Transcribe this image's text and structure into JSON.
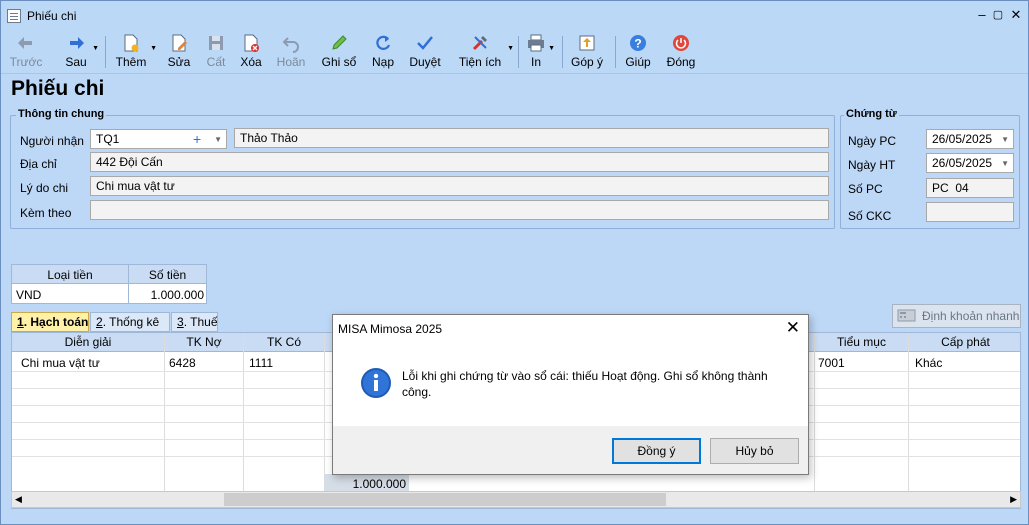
{
  "window": {
    "title": "Phiếu chi"
  },
  "toolbar": {
    "prev": "Trước",
    "next": "Sau",
    "add": "Thêm",
    "edit": "Sửa",
    "save": "Cất",
    "delete": "Xóa",
    "undo": "Hoãn",
    "post": "Ghi sổ",
    "reload": "Nạp",
    "approve": "Duyệt",
    "utilities": "Tiện ích",
    "print": "In",
    "feedback": "Góp ý",
    "help": "Giúp",
    "close": "Đóng"
  },
  "page": {
    "title": "Phiếu chi"
  },
  "general": {
    "group_label": "Thông tin chung",
    "recipient_label": "Người nhận",
    "recipient_code": "TQ1",
    "recipient_name": "Thảo Thảo",
    "address_label": "Địa chỉ",
    "address": "442 Đội Cấn",
    "reason_label": "Lý do chi",
    "reason": "Chi mua vật tư",
    "attach_label": "Kèm theo",
    "attach": ""
  },
  "voucher": {
    "group_label": "Chứng từ",
    "pc_date_label": "Ngày PC",
    "pc_date": "26/05/2025",
    "ht_date_label": "Ngày HT",
    "ht_date": "26/05/2025",
    "pc_no_label": "Số PC",
    "pc_no": "PC  04",
    "ckc_no_label": "Số CKC",
    "ckc_no": ""
  },
  "currency": {
    "h_type": "Loại tiền",
    "h_amount": "Số tiền",
    "type": "VND",
    "amount": "1.000.000"
  },
  "tabs": [
    {
      "num": "1",
      "label": ". Hạch toán"
    },
    {
      "num": "2",
      "label": ". Thống kê"
    },
    {
      "num": "3",
      "label": ". Thuế"
    }
  ],
  "quick_entry": "Định khoản nhanh",
  "grid": {
    "headers": {
      "desc": "Diễn giải",
      "debit": "TK Nợ",
      "credit": "TK Có",
      "sub": "Tiểu mục",
      "grant": "Cấp phát"
    },
    "row1": {
      "desc": "Chi mua vật tư",
      "debit": "6428",
      "credit": "1111",
      "sub": "7001",
      "grant": "Khác"
    },
    "total": "1.000.000"
  },
  "dialog": {
    "title": "MISA Mimosa 2025",
    "message": "Lỗi khi ghi chứng từ vào sổ cái: thiếu Hoạt động. Ghi sổ không thành công.",
    "ok": "Đồng ý",
    "cancel": "Hủy bỏ"
  },
  "colors": {
    "window_bg": "#bdd7f7",
    "active_tab": "#fff1a8",
    "dialog_accent": "#0078d7",
    "info_icon": "#1e5bb8"
  }
}
